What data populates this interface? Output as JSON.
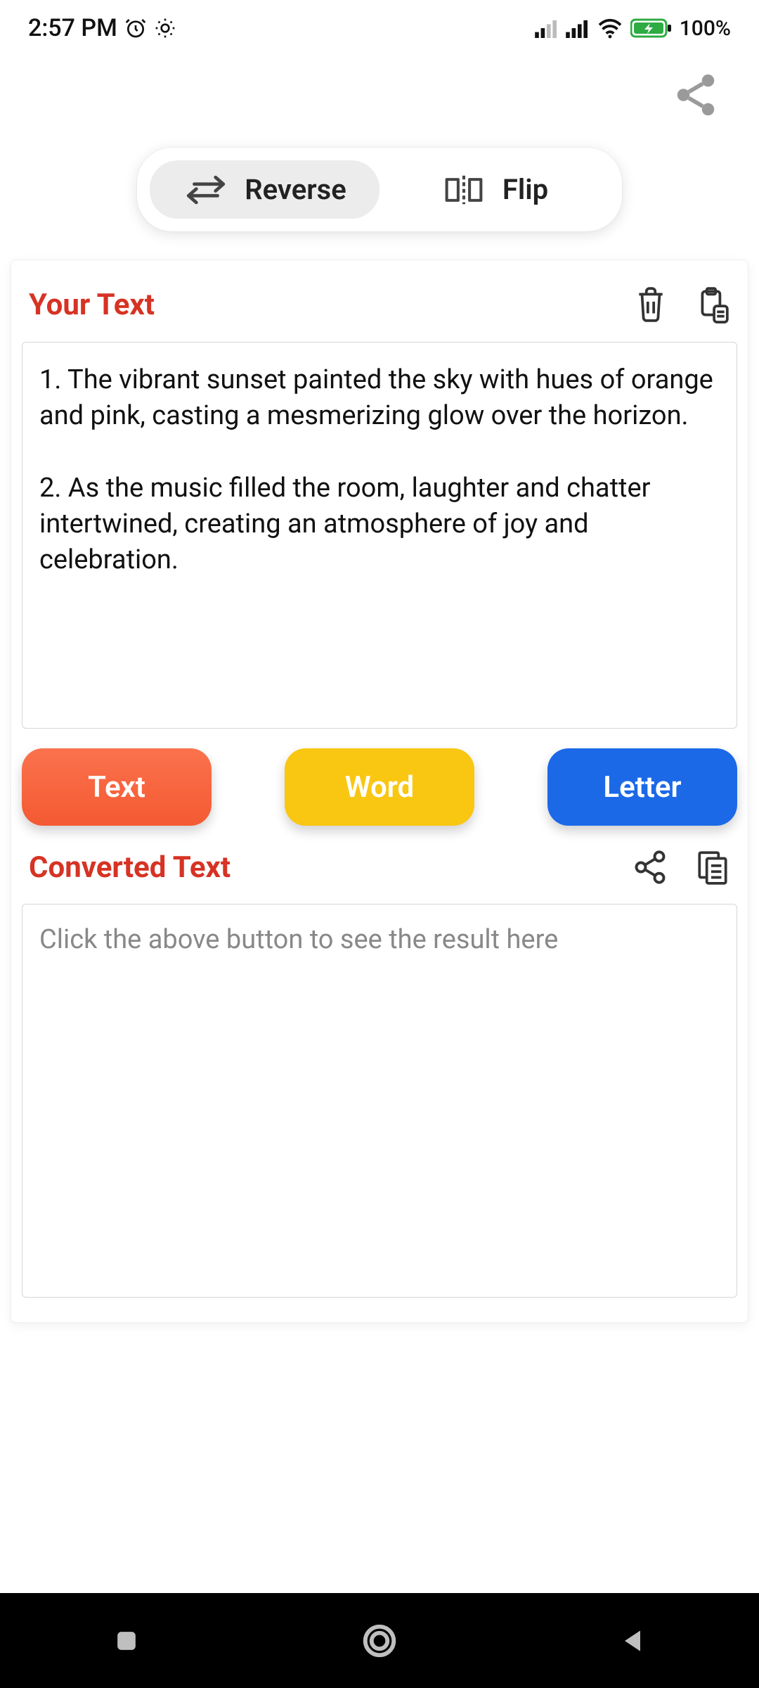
{
  "status": {
    "time": "2:57 PM",
    "battery_pct": "100%"
  },
  "tabs": {
    "reverse": "Reverse",
    "flip": "Flip"
  },
  "input": {
    "title": "Your Text",
    "text": "1. The vibrant sunset painted the sky with hues of orange and pink, casting a mesmerizing glow over the horizon.\n\n2. As the music filled the room, laughter and chatter intertwined, creating an atmosphere of joy and celebration."
  },
  "buttons": {
    "text": "Text",
    "word": "Word",
    "letter": "Letter"
  },
  "output": {
    "title": "Converted Text",
    "placeholder": "Click the above button to see the result here"
  },
  "colors": {
    "accent_red": "#d63324",
    "orange": "#f9643b",
    "yellow": "#f9c712",
    "blue": "#1c69e8"
  }
}
